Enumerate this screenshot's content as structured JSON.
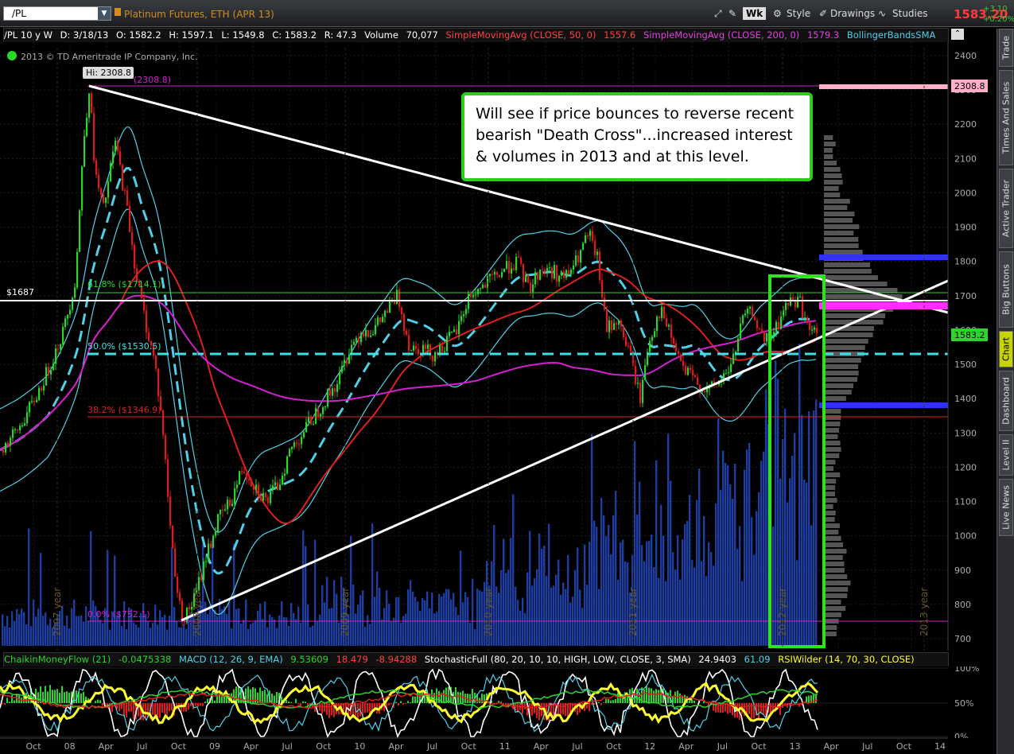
{
  "toolbar": {
    "symbol": "/PL",
    "instrument": "Platinum Futures, ETH (APR 13)",
    "aggregation": "Wk",
    "style": "Style",
    "drawings": "Drawings",
    "studies": "Studies",
    "last_price": "1583.20",
    "change": "+3.10",
    "change_pct": "+0.20%"
  },
  "study_bar": {
    "symbol_period": "/PL 10 y W",
    "date": "D: 3/18/13",
    "open": "O: 1582.2",
    "high": "H: 1597.1",
    "low": "L: 1549.8",
    "close": "C: 1583.2",
    "range": "R: 47.3",
    "volume_label": "Volume",
    "volume_value": "70,077",
    "sma50_label": "SimpleMovingAvg (CLOSE, 50, 0)",
    "sma50_value": "1557.6",
    "sma200_label": "SimpleMovingAvg (CLOSE, 200, 0)",
    "sma200_value": "1579.3",
    "bollinger_label": "BollingerBandsSMA"
  },
  "copyright": "2013 © TD Ameritrade IP Company, Inc.",
  "annotation_text": "Will see if price bounces to reverse recent bearish \"Death Cross\"...increased interest & volumes in 2013 and at this level.",
  "chart_labels": {
    "hi_label": "Hi: 2308.8",
    "hi_line_label": "(2308.8)",
    "hi_price_tag": "2308.8",
    "price_line_label": "$1687",
    "fib_618": "61.8%  ($1714.1)",
    "fib_500": "50.0%  ($1530.5)",
    "fib_382": "38.2%  ($1346.9)",
    "fib_0": "0.0%  ($752.1)",
    "current_price_tag": "1583.2"
  },
  "lower_study_bar": {
    "cmf": "ChaikinMoneyFlow (21)",
    "cmf_value": "-0.0475338",
    "macd": "MACD (12, 26, 9, EMA)",
    "macd_value": "9.53609",
    "macd_avg": "18.479",
    "macd_diff": "-8.94288",
    "stoch": "StochasticFull (80, 20, 10, 10, HIGH, LOW, CLOSE, 3, SMA)",
    "stoch_value": "24.9403",
    "stoch_value2": "61.09",
    "rsi": "RSIWilder (14, 70, 30, CLOSE)"
  },
  "side_tabs": [
    "Trade",
    "Times And Sales",
    "Active Trader",
    "Big Buttons",
    "Chart",
    "Dashboard",
    "Level II",
    "Live News"
  ],
  "colors": {
    "candle_up": "#2bd52b",
    "candle_down": "#e11a1a",
    "sma50": "#e01f1f",
    "sma200": "#d21fd2",
    "bollinger": "#4fd0e8",
    "volume": "#1e3da0",
    "annotation_border": "#2ecc1c"
  },
  "chart_data": {
    "type": "candlestick",
    "y_ticks": [
      "2400",
      "2300",
      "2200",
      "2100",
      "2000",
      "1900",
      "1800",
      "1700",
      "1600",
      "1500",
      "1400",
      "1300",
      "1200",
      "1100",
      "1000",
      "900",
      "800",
      "700"
    ],
    "ylim": [
      700,
      2430
    ],
    "x_ticks": [
      "Oct",
      "08",
      "Apr",
      "Jul",
      "Oct",
      "09",
      "Apr",
      "Jul",
      "Oct",
      "10",
      "Apr",
      "Jul",
      "Oct",
      "11",
      "Apr",
      "Jul",
      "Oct",
      "12",
      "Apr",
      "Jul",
      "Oct",
      "13",
      "Apr",
      "Jul",
      "Oct",
      "14"
    ],
    "year_markers": [
      "2007 year",
      "2008 year",
      "2009 year",
      "2010 year",
      "2011 year",
      "2012 year",
      "2013 year"
    ],
    "lower_ticks": [
      "100%",
      "50%",
      "0%"
    ],
    "price_path": [
      [
        0,
        1250
      ],
      [
        20,
        1300
      ],
      [
        40,
        1380
      ],
      [
        60,
        1480
      ],
      [
        80,
        1600
      ],
      [
        95,
        1750
      ],
      [
        105,
        2150
      ],
      [
        112,
        2308
      ],
      [
        120,
        2050
      ],
      [
        130,
        1950
      ],
      [
        145,
        2150
      ],
      [
        160,
        1950
      ],
      [
        172,
        1750
      ],
      [
        185,
        1600
      ],
      [
        195,
        1500
      ],
      [
        205,
        1300
      ],
      [
        215,
        1000
      ],
      [
        225,
        800
      ],
      [
        232,
        760
      ],
      [
        245,
        820
      ],
      [
        260,
        950
      ],
      [
        275,
        1050
      ],
      [
        290,
        1100
      ],
      [
        305,
        1200
      ],
      [
        320,
        1150
      ],
      [
        335,
        1100
      ],
      [
        350,
        1150
      ],
      [
        365,
        1250
      ],
      [
        380,
        1300
      ],
      [
        395,
        1350
      ],
      [
        410,
        1400
      ],
      [
        425,
        1450
      ],
      [
        440,
        1550
      ],
      [
        455,
        1600
      ],
      [
        470,
        1600
      ],
      [
        485,
        1650
      ],
      [
        500,
        1700
      ],
      [
        515,
        1550
      ],
      [
        530,
        1550
      ],
      [
        545,
        1530
      ],
      [
        560,
        1560
      ],
      [
        575,
        1600
      ],
      [
        590,
        1700
      ],
      [
        605,
        1720
      ],
      [
        620,
        1750
      ],
      [
        635,
        1780
      ],
      [
        650,
        1800
      ],
      [
        665,
        1720
      ],
      [
        680,
        1780
      ],
      [
        695,
        1770
      ],
      [
        710,
        1750
      ],
      [
        725,
        1800
      ],
      [
        740,
        1880
      ],
      [
        752,
        1800
      ],
      [
        762,
        1600
      ],
      [
        775,
        1630
      ],
      [
        790,
        1550
      ],
      [
        805,
        1400
      ],
      [
        815,
        1560
      ],
      [
        830,
        1660
      ],
      [
        845,
        1570
      ],
      [
        860,
        1480
      ],
      [
        875,
        1450
      ],
      [
        890,
        1420
      ],
      [
        905,
        1450
      ],
      [
        920,
        1500
      ],
      [
        935,
        1640
      ],
      [
        948,
        1650
      ],
      [
        960,
        1560
      ],
      [
        975,
        1600
      ],
      [
        990,
        1680
      ],
      [
        1005,
        1690
      ],
      [
        1015,
        1610
      ],
      [
        1022,
        1590
      ],
      [
        1028,
        1583
      ]
    ]
  }
}
